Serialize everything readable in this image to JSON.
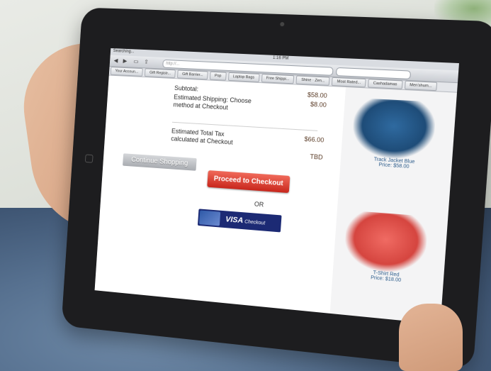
{
  "browser": {
    "carrier": "Searching...",
    "time": "1:16 PM",
    "nav_back": "◀",
    "nav_forward": "▶",
    "url": "http://...",
    "bookmarks": [
      "Your Accoun...",
      "Gift Registr...",
      "Gift Barrier...",
      "Pop",
      "Laptop Bags",
      "Free Shippi...",
      "Shine · Zen...",
      "Most Rated...",
      "Cashadamas",
      "Men'shum..."
    ]
  },
  "cart": {
    "subtotal_label": "Subtotal:",
    "subtotal_value": "$58.00",
    "shipping_label": "Estimated Shipping: Choose method at Checkout",
    "shipping_value": "$8.00",
    "total_label": "Estimated Total Tax calculated at Checkout",
    "total_value": "$66.00",
    "tax_value": "TBD"
  },
  "buttons": {
    "continue": "Continue Shopping",
    "checkout": "Proceed to Checkout",
    "or": "OR",
    "visa": "VISA",
    "visa_sub": "Checkout"
  },
  "products": [
    {
      "name": "Track Jacket Blue",
      "price": "Price: $58.00"
    },
    {
      "name": "T-Shirt Red",
      "price": "Price: $18.00"
    }
  ]
}
